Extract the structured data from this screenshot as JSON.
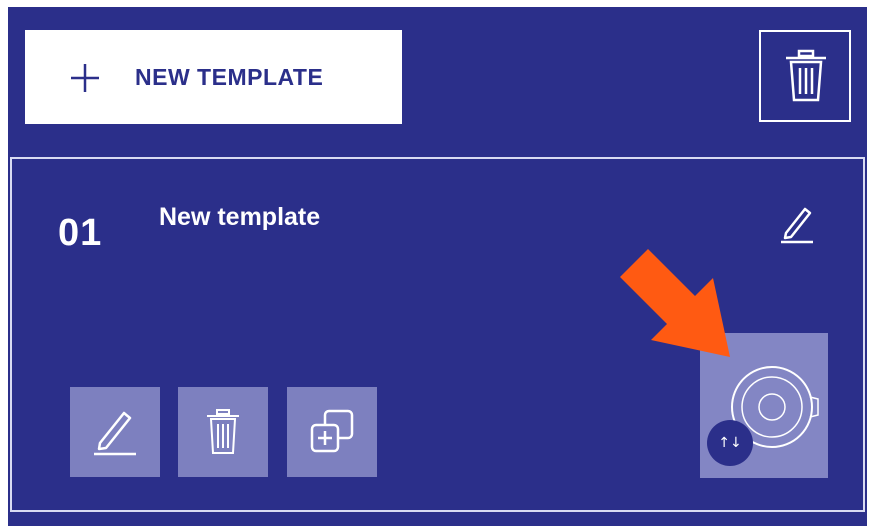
{
  "toolbar": {
    "new_template_label": "NEW TEMPLATE",
    "new_template_icon": "plus-icon",
    "delete_all_icon": "trash-icon"
  },
  "template": {
    "number": "01",
    "title": "New template",
    "rename_icon": "pencil-icon",
    "actions": {
      "edit_icon": "pencil-icon",
      "delete_icon": "trash-icon",
      "duplicate_icon": "duplicate-icon"
    },
    "cover_icon": "record-image-icon",
    "swap_badge": "↑↓"
  },
  "colors": {
    "panel_background": "#2b2f8a",
    "action_button": "#7d80bf",
    "cover_button": "#8386c4",
    "highlight_arrow": "#ff5a12"
  }
}
